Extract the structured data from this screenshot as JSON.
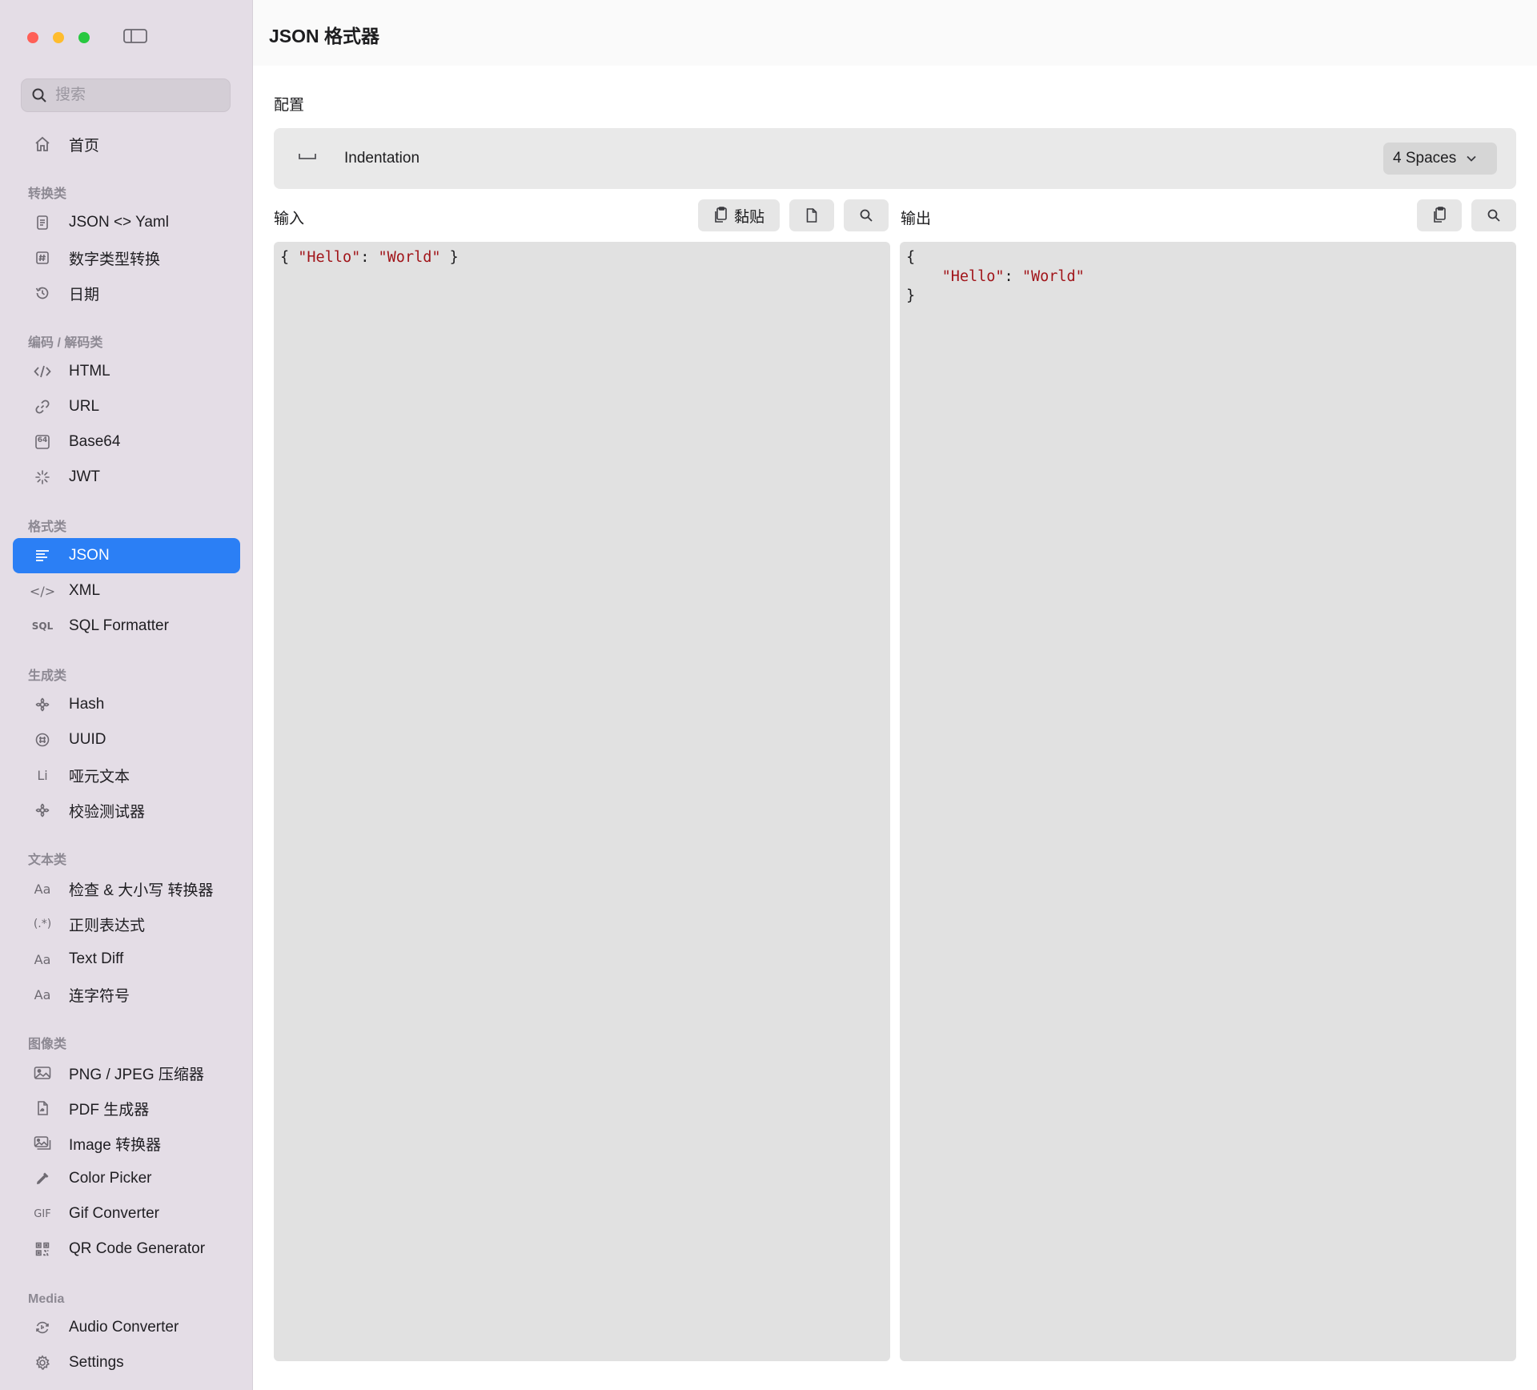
{
  "sidebar": {
    "search": {
      "placeholder": "搜索",
      "value": ""
    },
    "home": {
      "label": "首页",
      "icon": "house-icon"
    },
    "sections": [
      {
        "title": "转换类",
        "items": [
          {
            "label": "JSON <> Yaml",
            "icon": "document-icon"
          },
          {
            "label": "数字类型转换",
            "icon": "hash-icon"
          },
          {
            "label": "日期",
            "icon": "clock-history-icon"
          }
        ]
      },
      {
        "title": "编码 / 解码类",
        "items": [
          {
            "label": "HTML",
            "icon": "code-brackets-icon"
          },
          {
            "label": "URL",
            "icon": "link-icon"
          },
          {
            "label": "Base64",
            "icon": "base64-icon",
            "icon_text": "64"
          },
          {
            "label": "JWT",
            "icon": "sparkle-spinner-icon"
          }
        ]
      },
      {
        "title": "格式类",
        "items": [
          {
            "label": "JSON",
            "icon": "text-align-left-icon",
            "active": true
          },
          {
            "label": "XML",
            "icon": "xml-code-icon",
            "icon_text": "</>"
          },
          {
            "label": "SQL Formatter",
            "icon": "sql-icon",
            "icon_text": "SQL"
          }
        ]
      },
      {
        "title": "生成类",
        "items": [
          {
            "label": "Hash",
            "icon": "gear-flower-icon"
          },
          {
            "label": "UUID",
            "icon": "globe-grid-icon"
          },
          {
            "label": "哑元文本",
            "icon": "lorem-icon",
            "icon_text": "Li"
          },
          {
            "label": "校验测试器",
            "icon": "gear-flower-icon"
          }
        ]
      },
      {
        "title": "文本类",
        "items": [
          {
            "label": "检查 & 大小写 转换器",
            "icon": "text-case-icon",
            "icon_text": "Aa"
          },
          {
            "label": "正则表达式",
            "icon": "regex-icon",
            "icon_text": "(.*)"
          },
          {
            "label": "Text Diff",
            "icon": "text-case-icon",
            "icon_text": "Aa"
          },
          {
            "label": "连字符号",
            "icon": "text-case-icon",
            "icon_text": "Aa"
          }
        ]
      },
      {
        "title": "图像类",
        "items": [
          {
            "label": "PNG / JPEG 压缩器",
            "icon": "photo-icon"
          },
          {
            "label": "PDF 生成器",
            "icon": "pdf-document-icon"
          },
          {
            "label": "Image 转换器",
            "icon": "photo-stack-icon"
          },
          {
            "label": "Color Picker",
            "icon": "eyedropper-icon"
          },
          {
            "label": "Gif Converter",
            "icon": "gif-icon",
            "icon_text": "GIF"
          },
          {
            "label": "QR Code Generator",
            "icon": "qr-code-icon"
          }
        ]
      },
      {
        "title": "Media",
        "items": [
          {
            "label": "Audio Converter",
            "icon": "audio-cycle-icon"
          },
          {
            "label": "Settings",
            "icon": "gear-icon"
          }
        ]
      }
    ]
  },
  "main": {
    "title": "JSON 格式器",
    "config_label": "配置",
    "indentation": {
      "label": "Indentation",
      "value": "4 Spaces"
    },
    "input": {
      "label": "输入",
      "paste_label": "黏贴"
    },
    "output": {
      "label": "输出"
    },
    "input_code": {
      "open": "{ ",
      "key": "\"Hello\"",
      "sep": ": ",
      "val": "\"World\"",
      "close": " }"
    },
    "output_code": {
      "open": "{",
      "indent": "    ",
      "key": "\"Hello\"",
      "sep": ": ",
      "val": "\"World\"",
      "close": "}"
    }
  },
  "colors": {
    "accent": "#2b7ff5",
    "string": "#a1151a",
    "sidebar_bg": "#e4dde6",
    "editor_bg": "#e1e1e1"
  }
}
